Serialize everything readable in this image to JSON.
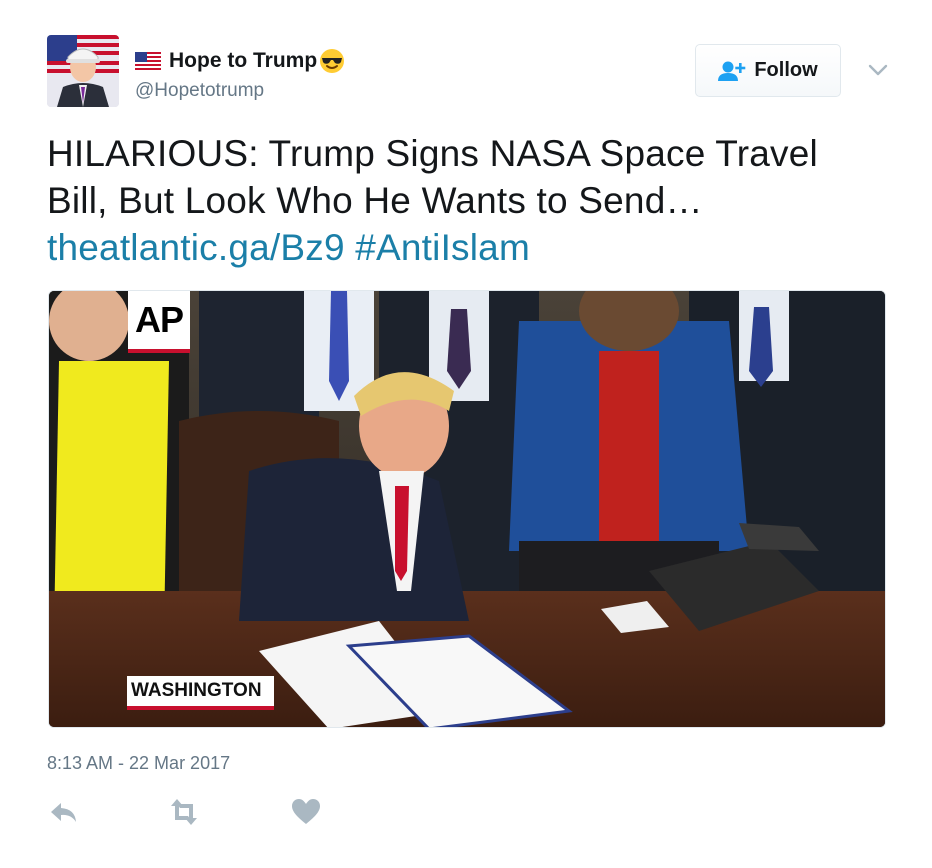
{
  "author": {
    "display_name": "Hope to Trump",
    "handle": "@Hopetotrump",
    "name_icons": [
      "us-flag-icon",
      "sunglasses-emoji-icon"
    ],
    "avatar": "avatar"
  },
  "follow_button": {
    "label": "Follow",
    "icon": "add-user-icon"
  },
  "menu": {
    "icon": "chevron-down-icon"
  },
  "tweet": {
    "line1": "HILARIOUS: Trump Signs NASA Space Travel",
    "line2": "Bill, But Look Who He Wants to Send…",
    "link": "theatlantic.ga/Bz9",
    "hashtag": "#AntiIslam"
  },
  "media": {
    "logo_text": "AP",
    "dateline": "WASHINGTON"
  },
  "timestamp": "8:13 AM - 22 Mar 2017",
  "actions": [
    "reply-icon",
    "retweet-icon",
    "like-icon"
  ],
  "colors": {
    "link": "#1b7fa8",
    "secondary_text": "#657786",
    "action_icon": "#aab8c2",
    "follow_icon": "#1da1f2",
    "ap_red": "#c8102e"
  }
}
